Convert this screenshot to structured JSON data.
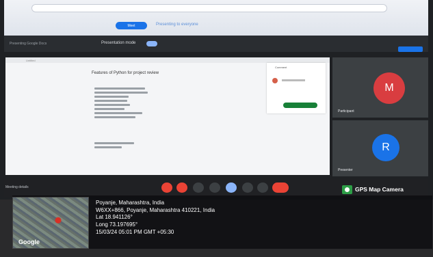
{
  "browser": {
    "tab_chip": "Meet",
    "tab_subtitle": "Presenting to everyone"
  },
  "meet_header": {
    "title": "Presenting Google Docs",
    "subtitle": "Presentation mode"
  },
  "document": {
    "tab": "Untitled",
    "heading": "Features of Python for project review",
    "comment_title": "Comment",
    "resolve_label": "Resolve"
  },
  "participants": [
    {
      "initial": "M",
      "name": "Participant",
      "color": "#d93d40"
    },
    {
      "initial": "R",
      "name": "Presenter",
      "color": "#1a73e8"
    }
  ],
  "controls": {
    "meeting_code": "Meeting details",
    "items": [
      "mic-icon",
      "camera-icon",
      "captions-icon",
      "emoji-icon",
      "present-icon",
      "raise-hand-icon",
      "more-icon",
      "end-call-icon"
    ]
  },
  "gps_camera": {
    "app_name": "GPS Map Camera",
    "map_provider": "Google",
    "location_title": "Poyanje, Maharashtra, India",
    "address": "W6XX+866, Poyanje, Maharashtra 410221, India",
    "lat": "Lat 18.941126°",
    "long": "Long 73.197695°",
    "timestamp": "15/03/24 05:01 PM GMT +05:30"
  }
}
